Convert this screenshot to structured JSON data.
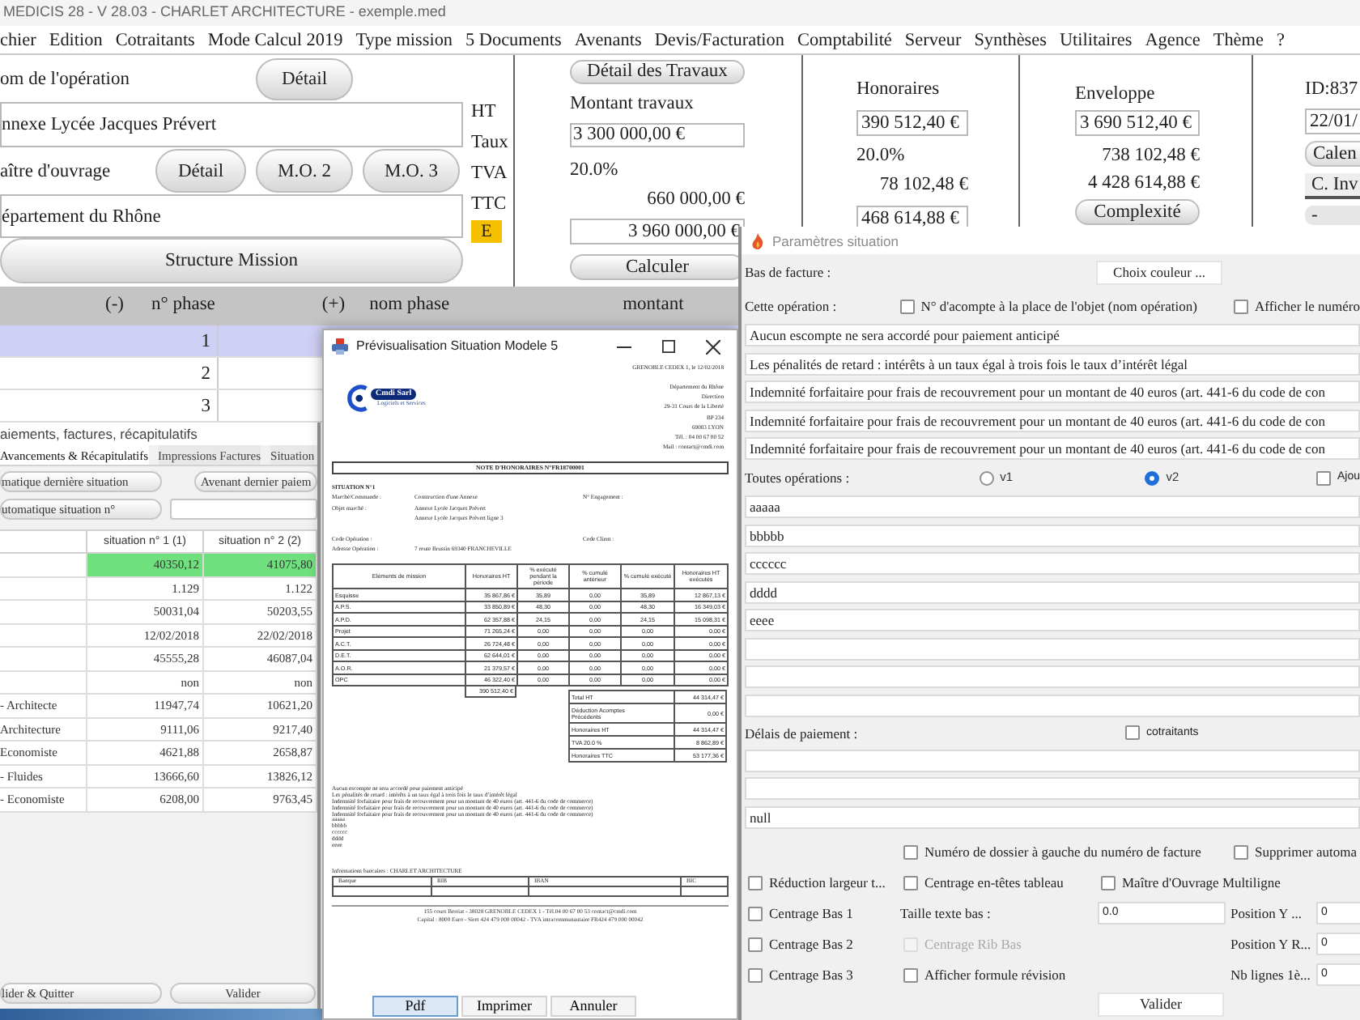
{
  "main_window": {
    "title": "MEDICIS 28 - V 28.03 - CHARLET ARCHITECTURE - exemple.med",
    "menu": [
      "chier",
      "Edition",
      "Cotraitants",
      "Mode Calcul 2019",
      "Type mission",
      "5 Documents",
      "Avenants",
      "Devis/Facturation",
      "Comptabilité",
      "Serveur",
      "Synthèses",
      "Utilitaires",
      "Agence",
      "Thème",
      "?"
    ],
    "operation": {
      "label": "om de l'opération",
      "button": "Détail",
      "value": "nnexe Lycée Jacques Prévert"
    },
    "owner": {
      "label": "aître d'ouvrage",
      "buttons": [
        "Détail",
        "M.O. 2",
        "M.O. 3"
      ],
      "value": "épartement du Rhône"
    },
    "structure_button": "Structure Mission",
    "amount_labels": [
      "HT",
      "Taux",
      "TVA",
      "TTC"
    ],
    "badge": "E",
    "works": {
      "button": "Détail des Travaux",
      "label": "Montant travaux",
      "amount": "3 300 000,00 €",
      "rate": "20.0%",
      "vat": "660 000,00 €",
      "total": "3 960 000,00 €",
      "calculate_button": "Calculer"
    },
    "fees": {
      "title": "Honoraires",
      "amount": "390 512,40 €",
      "rate": "20.0%",
      "vat": "78 102,48 €",
      "total": "468 614,88 €"
    },
    "envelope": {
      "title": "Enveloppe",
      "amount": "3 690 512,40 €",
      "vat": "738 102,48 €",
      "total": "4 428 614,88 €",
      "button": "Complexité"
    },
    "file": {
      "id": "ID:837",
      "date": "22/01/",
      "buttons": [
        "Calen",
        "C. Inv",
        "-"
      ]
    },
    "phase_table": {
      "columns": [
        "(-)",
        "n° phase",
        "(+)",
        "nom phase",
        "montant"
      ],
      "rows": [
        {
          "number": "1",
          "selected": true
        },
        {
          "number": "2",
          "selected": false
        },
        {
          "number": "3",
          "selected": false
        }
      ]
    }
  },
  "payments_dialog": {
    "title": "aiements, factures, récapitulatifs",
    "tabs": [
      {
        "label": "Avancements & Récapitulatifs",
        "selected": true
      },
      {
        "label": "Impressions Factures",
        "selected": false
      },
      {
        "label": "Situation",
        "selected": false
      }
    ],
    "last_situation_button": "matique dernière situation",
    "amendment_button": "Avenant dernier paiem",
    "situation_button": "utomatique situation n°",
    "table": {
      "columns": [
        "situation n° 1 (1)",
        "situation n° 2 (2)"
      ],
      "rows": [
        {
          "values": [
            "40350,12",
            "41075,80"
          ],
          "highlighted": true
        },
        {
          "values": [
            "1.129",
            "1.122"
          ],
          "highlighted": false
        },
        {
          "values": [
            "50031,04",
            "50203,55"
          ],
          "highlighted": false
        },
        {
          "values": [
            "12/02/2018",
            "22/02/2018"
          ],
          "highlighted": false
        },
        {
          "values": [
            "45555,28",
            "46087,04"
          ],
          "highlighted": false
        },
        {
          "values": [
            "non",
            "non"
          ],
          "highlighted": false
        },
        {
          "label": "- Architecte",
          "values": [
            "11947,74",
            "10621,20"
          ],
          "highlighted": false
        },
        {
          "label": "Architecture",
          "values": [
            "9111,06",
            "9217,40"
          ],
          "highlighted": false
        },
        {
          "label": "Economiste",
          "values": [
            "4621,88",
            "2658,87"
          ],
          "highlighted": false
        },
        {
          "label": "- Fluides",
          "values": [
            "13666,60",
            "13826,12"
          ],
          "highlighted": false
        },
        {
          "label": "- Economiste",
          "values": [
            "6208,00",
            "9763,45"
          ],
          "highlighted": false
        }
      ]
    },
    "buttons": [
      "lider & Quitter",
      "Valider"
    ]
  },
  "preview_window": {
    "title": "Prévisualisation Situation Modele 5",
    "document": {
      "place_date": "GRENOBLE CEDEX 1, le 12/02/2018",
      "logo": {
        "name": "Cmdi Sarl",
        "tagline": "Logiciels et Services"
      },
      "recipient": [
        "Département du Rhône",
        "Direction",
        "29-31 Cours de la Liberté",
        "BP 234",
        "69003 LYON",
        "Tél. : 04 00 67 00 52",
        "Mail : contact@cmdi.com"
      ],
      "title": "NOTE D'HONORAIRES N°FR18700001",
      "situation": "SITUATION N°1",
      "info_groups": [
        [
          {
            "label": "Marché/Commande :",
            "value": "Construction d'une Annexe",
            "side": "N° Engagement :"
          },
          {
            "label": "Objet marché :",
            "value": "Annexe Lycée Jacques Prévert"
          },
          {
            "value": "Annexe Lycée Jacques Prévert ligne 3"
          }
        ],
        [
          {
            "label": "Code Opération :",
            "side": "Code Client :"
          },
          {
            "label": "Adresse Opération :",
            "value": "7 route Brussin 69340 FRANCHEVILLE"
          }
        ]
      ],
      "table": {
        "columns": [
          "Eléments de mission",
          "Honoraires HT",
          "% exécuté pendant la période",
          "% cumulé antérieur",
          "% cumulé exécuté",
          "Honoraires HT exécutés"
        ],
        "rows": [
          [
            "Esquisse",
            "35 867,86 €",
            "35,89",
            "0,00",
            "35,89",
            "12 867,13 €"
          ],
          [
            "A.P.S.",
            "33 850,89 €",
            "48,30",
            "0,00",
            "48,30",
            "16 349,03 €"
          ],
          [
            "A.P.D.",
            "62 357,88 €",
            "24,15",
            "0,00",
            "24,15",
            "15 098,31 €"
          ],
          [
            "Projet",
            "71 265,24 €",
            "0,00",
            "0,00",
            "0,00",
            "0,00 €"
          ],
          [
            "A.C.T.",
            "26 724,48 €",
            "0,00",
            "0,00",
            "0,00",
            "0,00 €"
          ],
          [
            "D.E.T.",
            "62 644,01 €",
            "0,00",
            "0,00",
            "0,00",
            "0,00 €"
          ],
          [
            "A.O.R.",
            "21 379,57 €",
            "0,00",
            "0,00",
            "0,00",
            "0,00 €"
          ],
          [
            "OPC",
            "46 322,40 €",
            "0,00",
            "0,00",
            "0,00",
            "0,00 €"
          ]
        ],
        "total": "390 512,40 €"
      },
      "totals": [
        {
          "label": "Total HT",
          "value": "44 314,47 €"
        },
        {
          "label": "Déduction Acomptes Précédents",
          "value": "0,00 €"
        },
        {
          "label": "Honoraires HT",
          "value": "44 314,47 €"
        },
        {
          "label": "TVA 20.0 %",
          "value": "8 862,89 €"
        },
        {
          "label": "Honoraires TTC",
          "value": "53 177,36 €"
        }
      ],
      "conditions": [
        "Aucun escompte ne sera accordé pour paiement anticipé",
        "Les pénalités de retard : intérêts à un taux égal à trois fois le taux d’intérêt légal",
        "Indemnité forfaitaire pour frais de recouvrement pour un montant de 40 euros (art. 441-6 du code de commerce)",
        "Indemnité forfaitaire pour frais de recouvrement pour un montant de 40 euros (art. 441-6 du code de commerce)",
        "Indemnité forfaitaire pour frais de recouvrement pour un montant de 40 euros (art. 441-6 du code de commerce)",
        "aaaaa",
        "bbbbb",
        "cccccc",
        "dddd",
        "eeee"
      ],
      "bank": {
        "label": "Informations bancaires : CHARLET ARCHITECTURE",
        "columns": [
          "Banque",
          "RIB",
          "IBAN",
          "BIC"
        ]
      },
      "footer": [
        "155 cours Berriat - 38028 GRENOBLE CEDEX 1 - Tél.04 00 67 00 53 contact@cmdi.com",
        "Capital : 8000 Euro - Siret 424 479 000 00042 - TVA intracommunautaire FR424 479 000 00042"
      ]
    },
    "buttons": [
      {
        "label": "Pdf",
        "focused": true
      },
      {
        "label": "Imprimer",
        "focused": false
      },
      {
        "label": "Annuler",
        "focused": false
      }
    ]
  },
  "params_window": {
    "title": "Paramètres situation",
    "footer_label": "Bas de facture :",
    "color_button": "Choix couleur ...",
    "operation_label": "Cette opération :",
    "operation_options": [
      {
        "label": "N° d'acompte à la place de l'objet (nom opération)",
        "checked": false
      },
      {
        "label": "Afficher le numéro",
        "checked": false
      }
    ],
    "operation_lines": [
      "Aucun escompte ne sera accordé pour paiement anticipé",
      "Les pénalités de retard : intérêts à un taux égal à trois fois le taux d’intérêt légal",
      "Indemnité forfaitaire pour frais de recouvrement pour un montant de 40 euros (art. 441-6 du code de con",
      "Indemnité forfaitaire pour frais de recouvrement pour un montant de 40 euros (art. 441-6 du code de con",
      "Indemnité forfaitaire pour frais de recouvrement pour un montant de 40 euros (art. 441-6 du code de con"
    ],
    "all_label": "Toutes opérations :",
    "versions": [
      {
        "label": "v1",
        "selected": false
      },
      {
        "label": "v2",
        "selected": true
      }
    ],
    "all_option": {
      "label": "Ajou",
      "checked": false
    },
    "all_lines": [
      {
        "kind": "text",
        "value": "aaaaa"
      },
      {
        "kind": "text",
        "value": "bbbbb"
      },
      {
        "kind": "text",
        "value": "cccccc"
      },
      {
        "kind": "text",
        "value": "dddd"
      },
      {
        "kind": "text",
        "value": "eeee"
      },
      {
        "kind": "empty"
      },
      {
        "kind": "empty"
      },
      {
        "kind": "empty"
      }
    ],
    "payment_label": "Délais de paiement :",
    "cotraitants": {
      "label": "cotraitants",
      "checked": false
    },
    "payment_lines": [
      {
        "kind": "empty"
      },
      {
        "kind": "empty"
      },
      {
        "kind": "text",
        "value": "null"
      }
    ],
    "options": {
      "folder_number": {
        "label": "Numéro de dossier à gauche du numéro de facture",
        "checked": false,
        "disabled": false
      },
      "auto_delete": {
        "label": "Supprimer automa",
        "checked": false,
        "disabled": false
      },
      "narrow_width": {
        "label": "Réduction largeur t...",
        "checked": false,
        "disabled": false
      },
      "center_headers": {
        "label": "Centrage en-têtes tableau",
        "checked": false,
        "disabled": false
      },
      "multiline_owner": {
        "label": "Maître d'Ouvrage Multiligne",
        "checked": false,
        "disabled": false
      },
      "bottom_rows": [
        {
          "check": {
            "label": "Centrage Bas 1",
            "checked": false,
            "disabled": false
          },
          "middle": {
            "kind": "field",
            "label": "Taille texte bas :",
            "value": "0.0"
          },
          "position": {
            "label": "Position Y ...",
            "value": "0"
          }
        },
        {
          "check": {
            "label": "Centrage Bas 2",
            "checked": false,
            "disabled": false
          },
          "middle": {
            "kind": "check",
            "label": "Centrage Rib Bas",
            "checked": false,
            "disabled": true
          },
          "position": {
            "label": "Position Y R...",
            "value": "0"
          }
        },
        {
          "check": {
            "label": "Centrage Bas 3",
            "checked": false,
            "disabled": false
          },
          "middle": {
            "kind": "check",
            "label": "Afficher formule révision",
            "checked": false,
            "disabled": false
          },
          "position": {
            "label": "Nb lignes 1è...",
            "value": "0"
          }
        }
      ]
    },
    "submit_button": "Valider"
  }
}
